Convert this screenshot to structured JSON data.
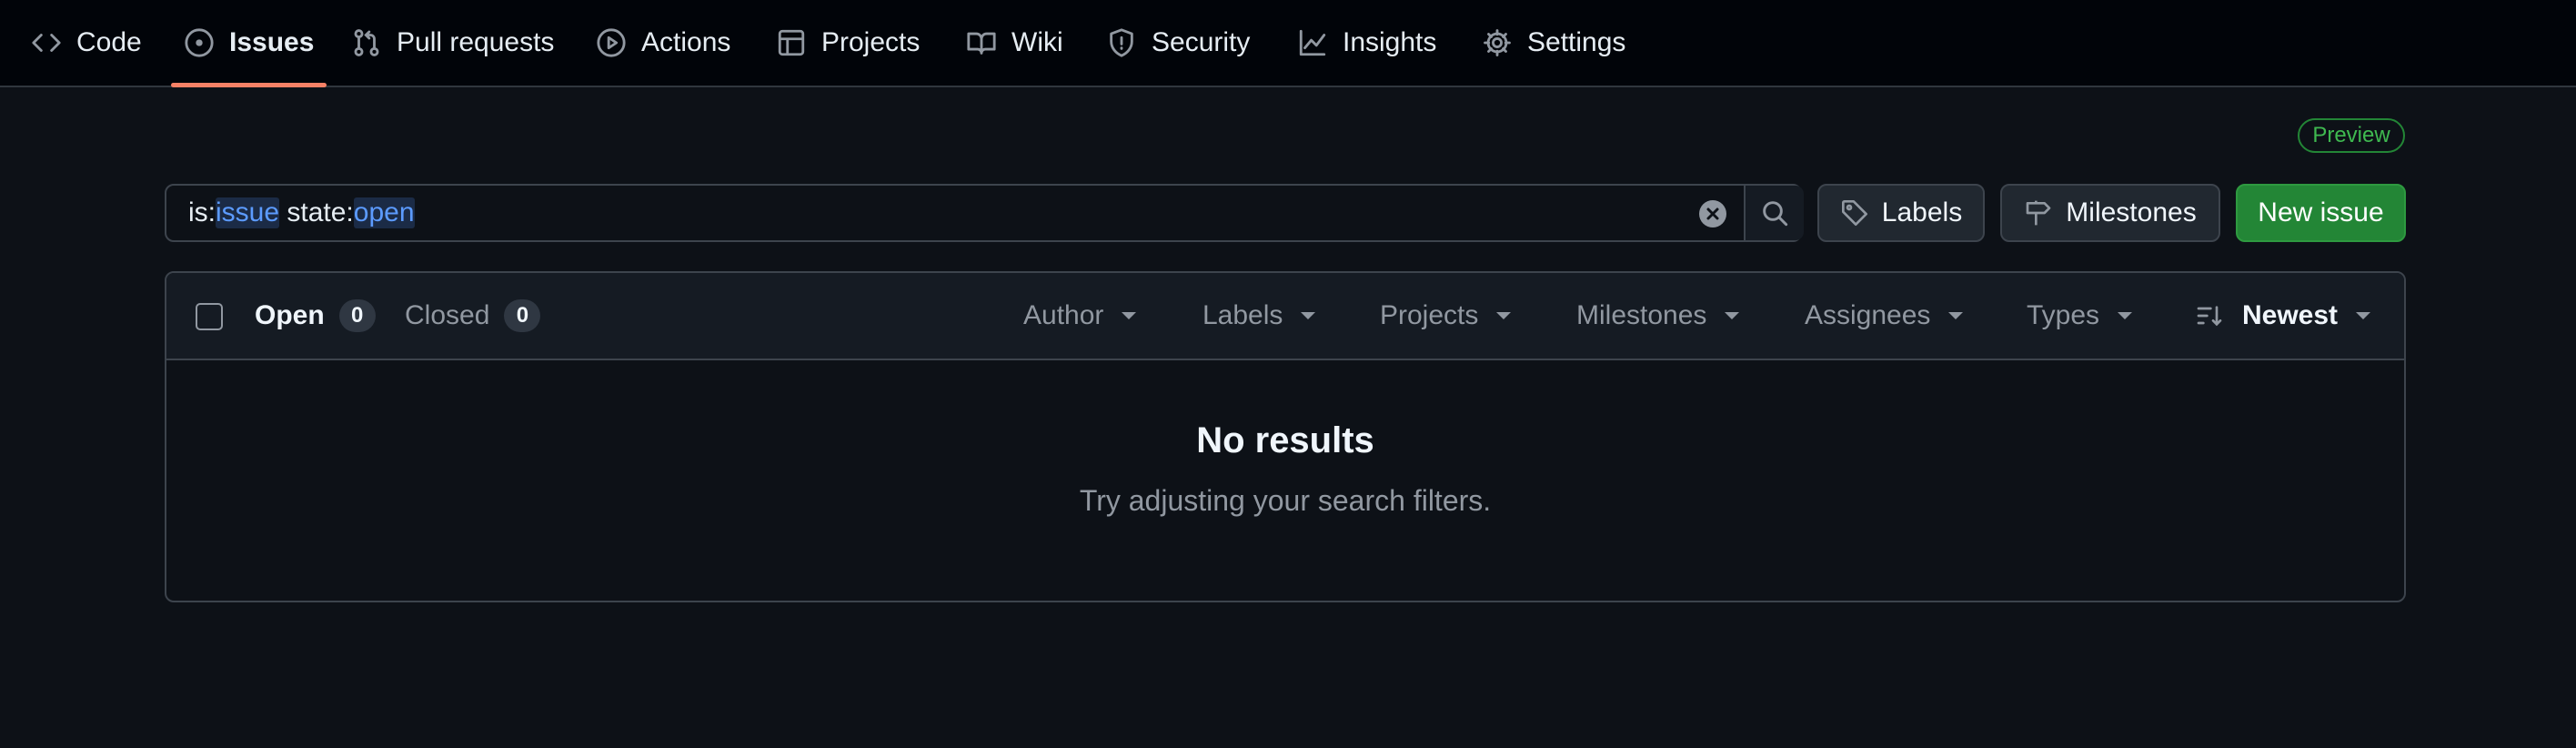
{
  "nav": {
    "tabs": [
      {
        "label": "Code",
        "icon": "code-icon"
      },
      {
        "label": "Issues",
        "icon": "issue-opened-icon",
        "active": true
      },
      {
        "label": "Pull requests",
        "icon": "git-pull-request-icon"
      },
      {
        "label": "Actions",
        "icon": "play-icon"
      },
      {
        "label": "Projects",
        "icon": "table-icon"
      },
      {
        "label": "Wiki",
        "icon": "book-icon"
      },
      {
        "label": "Security",
        "icon": "shield-icon"
      },
      {
        "label": "Insights",
        "icon": "graph-icon"
      },
      {
        "label": "Settings",
        "icon": "gear-icon"
      }
    ]
  },
  "preview_badge": "Preview",
  "search": {
    "prefix1": "is:",
    "value1": "issue",
    "prefix2": " state:",
    "value2": "open"
  },
  "buttons": {
    "labels": "Labels",
    "milestones": "Milestones",
    "new_issue": "New issue"
  },
  "states": {
    "open_label": "Open",
    "open_count": "0",
    "closed_label": "Closed",
    "closed_count": "0"
  },
  "filters": {
    "author": "Author",
    "labels": "Labels",
    "projects": "Projects",
    "milestones": "Milestones",
    "assignees": "Assignees",
    "types": "Types",
    "sort": "Newest"
  },
  "empty": {
    "title": "No results",
    "subtitle": "Try adjusting your search filters."
  },
  "colors": {
    "background": "#0d1117",
    "nav_background": "#010409",
    "active_tab_underline": "#f78166",
    "primary_button": "#238636",
    "preview_badge": "#3fb950",
    "search_token": "#5c9bff"
  }
}
